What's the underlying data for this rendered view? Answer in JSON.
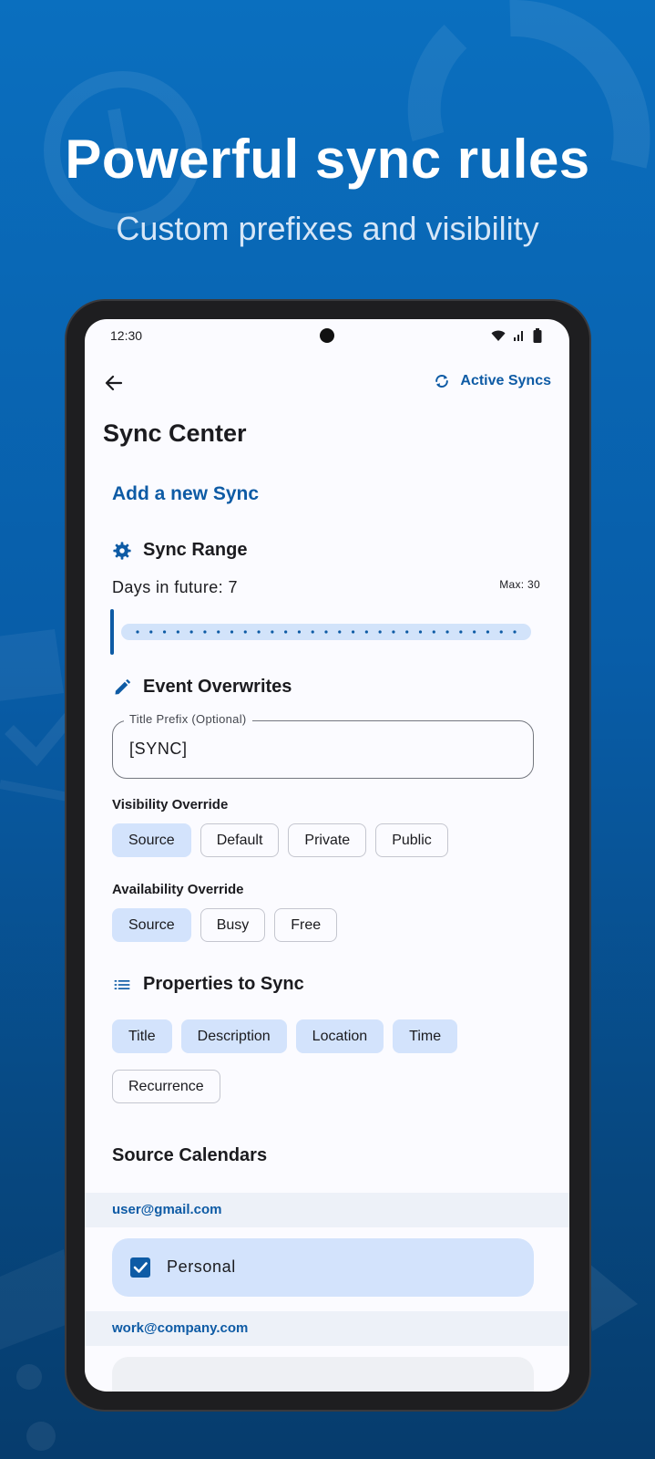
{
  "hero": {
    "title": "Powerful sync rules",
    "subtitle": "Custom prefixes and visibility"
  },
  "status_bar": {
    "time": "12:30",
    "icons": [
      "wifi-icon",
      "signal-icon",
      "battery-icon"
    ]
  },
  "top_bar": {
    "back_icon": "arrow-left-icon",
    "active_syncs_label": "Active Syncs",
    "active_syncs_icon": "sync-icon"
  },
  "page": {
    "title": "Sync Center",
    "add_sync_label": "Add a new Sync"
  },
  "sync_range": {
    "heading": "Sync Range",
    "icon": "gear-icon",
    "days_label": "Days in future: 7",
    "max_label": "Max: 30",
    "slider": {
      "value": 7,
      "max": 30
    }
  },
  "event_overwrites": {
    "heading": "Event Overwrites",
    "icon": "pencil-icon",
    "title_prefix": {
      "label": "Title Prefix (Optional)",
      "value": "[SYNC]"
    },
    "visibility": {
      "label": "Visibility Override",
      "options": [
        "Source",
        "Default",
        "Private",
        "Public"
      ],
      "selected": "Source"
    },
    "availability": {
      "label": "Availability Override",
      "options": [
        "Source",
        "Busy",
        "Free"
      ],
      "selected": "Source"
    }
  },
  "properties": {
    "heading": "Properties to Sync",
    "icon": "list-icon",
    "row1": [
      "Title",
      "Description",
      "Location",
      "Time"
    ],
    "row2": [
      "Recurrence"
    ],
    "selected": [
      "Title",
      "Description",
      "Location",
      "Time"
    ]
  },
  "source_calendars": {
    "heading": "Source Calendars",
    "accounts": [
      {
        "email": "user@gmail.com",
        "calendars": [
          {
            "name": "Personal",
            "checked": true
          }
        ]
      },
      {
        "email": "work@company.com",
        "calendars": []
      }
    ]
  },
  "colors": {
    "accent": "#0e5ba5",
    "chip_selected": "#d3e3fc",
    "background_top": "#0a6fbf",
    "background_bottom": "#063c6d"
  }
}
